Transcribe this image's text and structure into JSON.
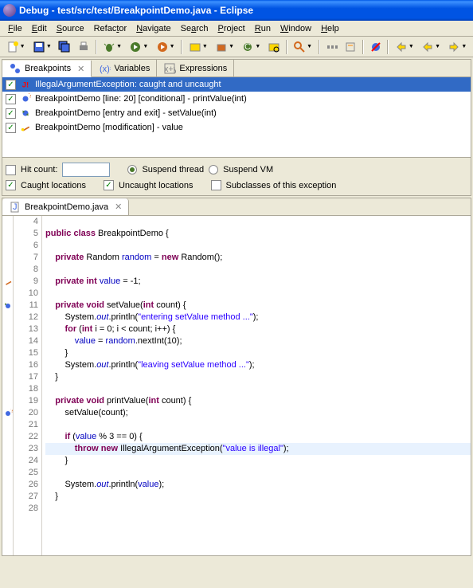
{
  "titlebar": {
    "text": "Debug - test/src/test/BreakpointDemo.java - Eclipse"
  },
  "menubar": {
    "items": [
      "File",
      "Edit",
      "Source",
      "Refactor",
      "Navigate",
      "Search",
      "Project",
      "Run",
      "Window",
      "Help"
    ]
  },
  "views": {
    "tabs": {
      "breakpoints": "Breakpoints",
      "variables": "Variables",
      "expressions": "Expressions"
    }
  },
  "breakpoints": {
    "items": [
      {
        "label": "IllegalArgumentException: caught and uncaught",
        "icon": "exception"
      },
      {
        "label": "BreakpointDemo [line: 20] [conditional] - printValue(int)",
        "icon": "line"
      },
      {
        "label": "BreakpointDemo [entry and exit] - setValue(int)",
        "icon": "method"
      },
      {
        "label": "BreakpointDemo [modification] - value",
        "icon": "watch"
      }
    ]
  },
  "bp_options": {
    "hit_count_label": "Hit count:",
    "hit_count_value": "",
    "suspend_thread": "Suspend thread",
    "suspend_vm": "Suspend VM",
    "caught": "Caught locations",
    "uncaught": "Uncaught locations",
    "subclasses": "Subclasses of this exception"
  },
  "editor": {
    "tab_name": "BreakpointDemo.java",
    "lines": [
      4,
      5,
      6,
      7,
      8,
      9,
      10,
      11,
      12,
      13,
      14,
      15,
      16,
      17,
      18,
      19,
      20,
      21,
      22,
      23,
      24,
      25,
      26,
      27,
      28
    ]
  },
  "chart_data": {
    "type": "table",
    "title": "Java source code",
    "rows": [
      {
        "line": 4,
        "code": ""
      },
      {
        "line": 5,
        "code": "public class BreakpointDemo {"
      },
      {
        "line": 6,
        "code": ""
      },
      {
        "line": 7,
        "code": "    private Random random = new Random();"
      },
      {
        "line": 8,
        "code": ""
      },
      {
        "line": 9,
        "code": "    private int value = -1;"
      },
      {
        "line": 10,
        "code": ""
      },
      {
        "line": 11,
        "code": "    private void setValue(int count) {"
      },
      {
        "line": 12,
        "code": "        System.out.println(\"entering setValue method ...\");"
      },
      {
        "line": 13,
        "code": "        for (int i = 0; i < count; i++) {"
      },
      {
        "line": 14,
        "code": "            value = random.nextInt(10);"
      },
      {
        "line": 15,
        "code": "        }"
      },
      {
        "line": 16,
        "code": "        System.out.println(\"leaving setValue method ...\");"
      },
      {
        "line": 17,
        "code": "    }"
      },
      {
        "line": 18,
        "code": ""
      },
      {
        "line": 19,
        "code": "    private void printValue(int count) {"
      },
      {
        "line": 20,
        "code": "        setValue(count);"
      },
      {
        "line": 21,
        "code": ""
      },
      {
        "line": 22,
        "code": "        if (value % 3 == 0) {"
      },
      {
        "line": 23,
        "code": "            throw new IllegalArgumentException(\"value is illegal\");"
      },
      {
        "line": 24,
        "code": "        }"
      },
      {
        "line": 25,
        "code": ""
      },
      {
        "line": 26,
        "code": "        System.out.println(value);"
      },
      {
        "line": 27,
        "code": "    }"
      },
      {
        "line": 28,
        "code": ""
      }
    ]
  }
}
